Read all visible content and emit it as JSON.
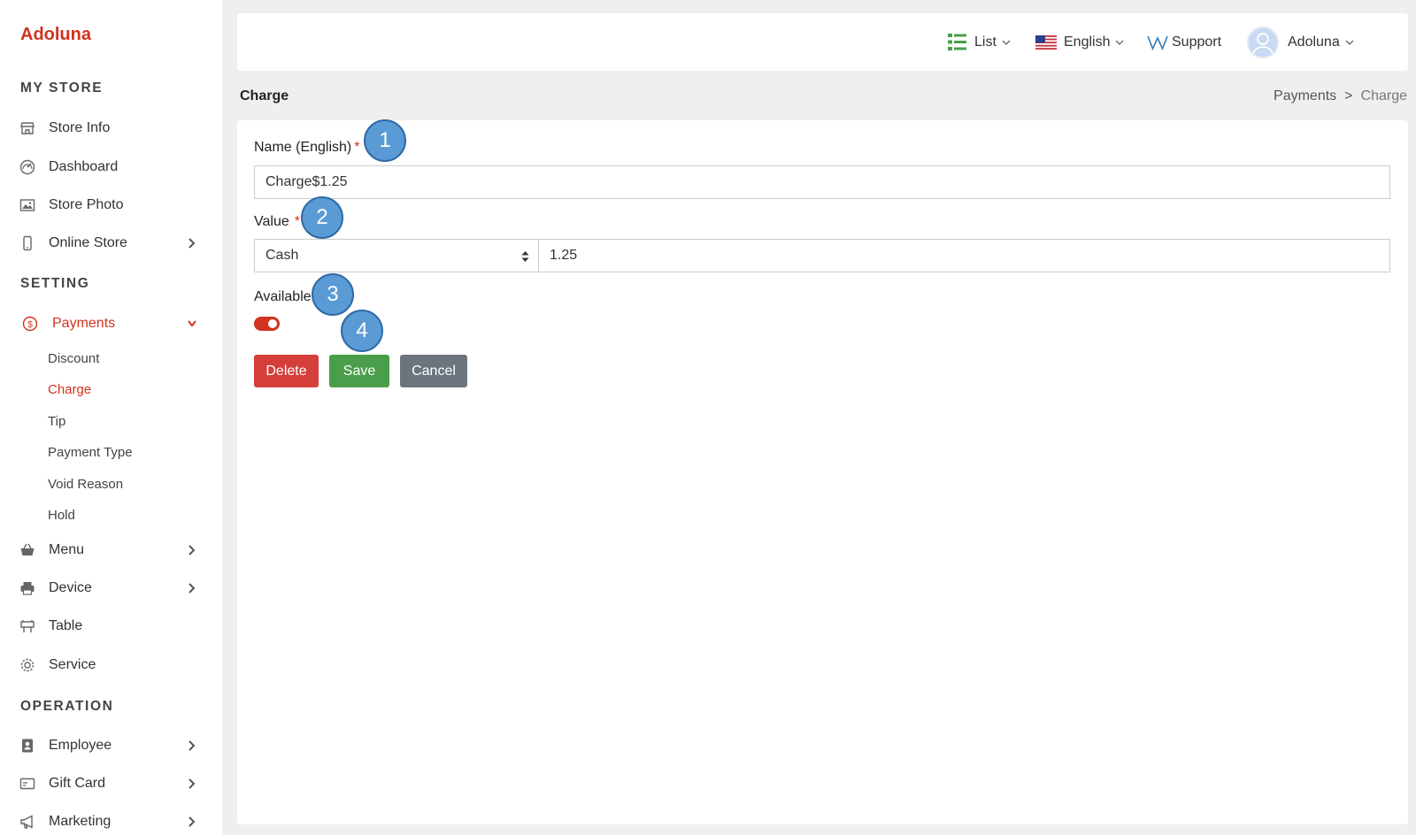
{
  "brand": "Adoluna",
  "sidebar": {
    "sections": [
      "MY STORE",
      "SETTING",
      "OPERATION"
    ],
    "items": [
      {
        "label": "Store Info",
        "icon": "store-icon"
      },
      {
        "label": "Dashboard",
        "icon": "dashboard-icon"
      },
      {
        "label": "Store Photo",
        "icon": "photo-icon"
      },
      {
        "label": "Online Store",
        "icon": "mobile-icon",
        "has_children": true
      },
      {
        "label": "Payments",
        "icon": "dollar-icon",
        "expanded": true,
        "active": true
      },
      {
        "label": "Menu",
        "icon": "basket-icon",
        "has_children": true
      },
      {
        "label": "Device",
        "icon": "printer-icon",
        "has_children": true
      },
      {
        "label": "Table",
        "icon": "table-icon"
      },
      {
        "label": "Service",
        "icon": "gear-icon"
      },
      {
        "label": "Employee",
        "icon": "badge-icon",
        "has_children": true
      },
      {
        "label": "Gift Card",
        "icon": "card-icon",
        "has_children": true
      },
      {
        "label": "Marketing",
        "icon": "megaphone-icon",
        "has_children": true
      }
    ],
    "payments_sub": [
      "Discount",
      "Charge",
      "Tip",
      "Payment Type",
      "Void Reason",
      "Hold"
    ],
    "active_sub": "Charge"
  },
  "topbar": {
    "list": "List",
    "language": "English",
    "support": "Support",
    "user": "Adoluna"
  },
  "page": {
    "title": "Charge",
    "breadcrumb": [
      "Payments",
      "Charge"
    ],
    "breadcrumb_sep": ">"
  },
  "form": {
    "name_label": "Name (English)",
    "name_value": "Charge$1.25",
    "value_label": "Value",
    "required_mark": "*",
    "value_type": "Cash",
    "value_amount": "1.25",
    "available_label": "Available",
    "available": true,
    "delete_label": "Delete",
    "save_label": "Save",
    "cancel_label": "Cancel"
  },
  "annotations": [
    "1",
    "2",
    "3",
    "4"
  ],
  "colors": {
    "accent": "#d2321e",
    "save": "#4a9d4a",
    "delete": "#d43f3a",
    "cancel": "#6c757d",
    "bubble": "#5b9bd5"
  }
}
